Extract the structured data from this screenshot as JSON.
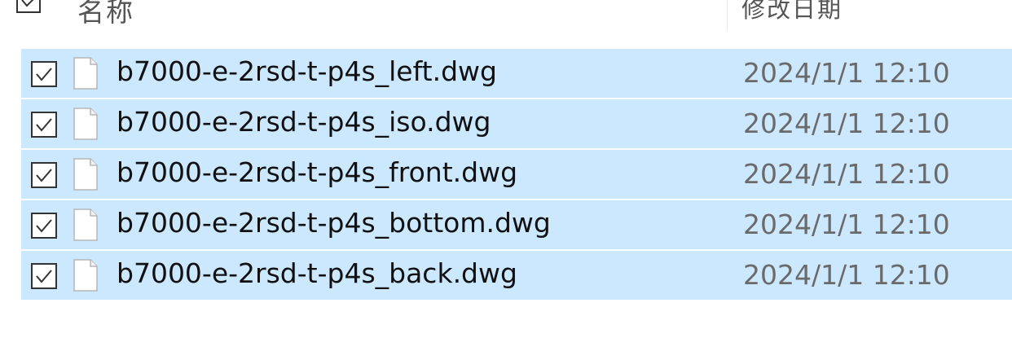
{
  "header": {
    "name_label": "名称",
    "date_label": "修改日期"
  },
  "files": [
    {
      "name": "b7000-e-2rsd-t-p4s_left.dwg",
      "date": "2024/1/1 12:10",
      "checked": true,
      "icon": "blank-file-icon"
    },
    {
      "name": "b7000-e-2rsd-t-p4s_iso.dwg",
      "date": "2024/1/1 12:10",
      "checked": true,
      "icon": "blank-file-icon"
    },
    {
      "name": "b7000-e-2rsd-t-p4s_front.dwg",
      "date": "2024/1/1 12:10",
      "checked": true,
      "icon": "blank-file-icon"
    },
    {
      "name": "b7000-e-2rsd-t-p4s_bottom.dwg",
      "date": "2024/1/1 12:10",
      "checked": true,
      "icon": "blank-file-icon"
    },
    {
      "name": "b7000-e-2rsd-t-p4s_back.dwg",
      "date": "2024/1/1 12:10",
      "checked": true,
      "icon": "blank-file-icon"
    }
  ],
  "colors": {
    "selection": "#cce8ff",
    "date_text": "#6a6a6a",
    "name_text": "#111111"
  }
}
